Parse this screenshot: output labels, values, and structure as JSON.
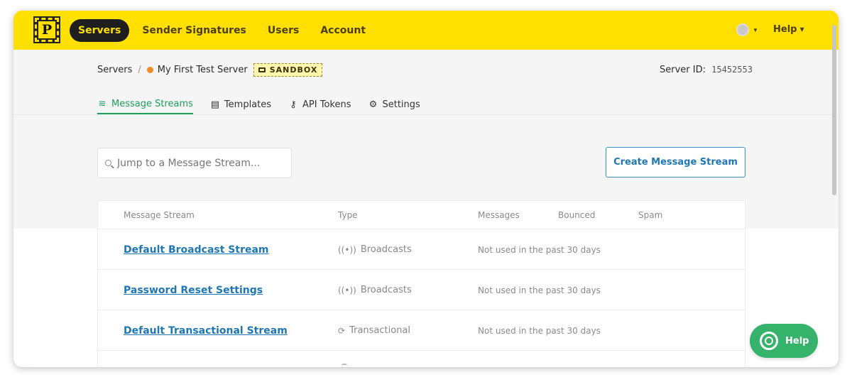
{
  "topnav": {
    "logo_letter": "P",
    "items": [
      {
        "label": "Servers",
        "active": true
      },
      {
        "label": "Sender Signatures",
        "active": false
      },
      {
        "label": "Users",
        "active": false
      },
      {
        "label": "Account",
        "active": false
      }
    ],
    "help_label": "Help"
  },
  "breadcrumb": {
    "root": "Servers",
    "separator": "/",
    "server_name": "My First Test Server",
    "badge": "SANDBOX"
  },
  "server_id": {
    "label": "Server ID:",
    "value": "15452553"
  },
  "tabs": [
    {
      "label": "Message Streams",
      "icon": "streams-icon",
      "active": true
    },
    {
      "label": "Templates",
      "icon": "template-icon",
      "active": false
    },
    {
      "label": "API Tokens",
      "icon": "key-icon",
      "active": false
    },
    {
      "label": "Settings",
      "icon": "gear-icon",
      "active": false
    }
  ],
  "search": {
    "placeholder": "Jump to a Message Stream..."
  },
  "create_button": "Create Message Stream",
  "table": {
    "headers": {
      "stream": "Message Stream",
      "type": "Type",
      "messages": "Messages",
      "bounced": "Bounced",
      "spam": "Spam"
    },
    "rows": [
      {
        "name": "Default Broadcast Stream",
        "type": "Broadcasts",
        "type_icon": "broadcast-icon",
        "messages": "Not used in the past 30 days"
      },
      {
        "name": "Password Reset Settings",
        "type": "Broadcasts",
        "type_icon": "broadcast-icon",
        "messages": "Not used in the past 30 days"
      },
      {
        "name": "Default Transactional Stream",
        "type": "Transactional",
        "type_icon": "transactional-icon",
        "messages": "Not used in the past 30 days"
      }
    ]
  },
  "help_fab": "Help",
  "colors": {
    "brand_yellow": "#ffe000",
    "active_green": "#1d9f5c",
    "link_blue": "#1f77b4",
    "status_orange": "#f08a24",
    "help_green": "#35b36a"
  }
}
